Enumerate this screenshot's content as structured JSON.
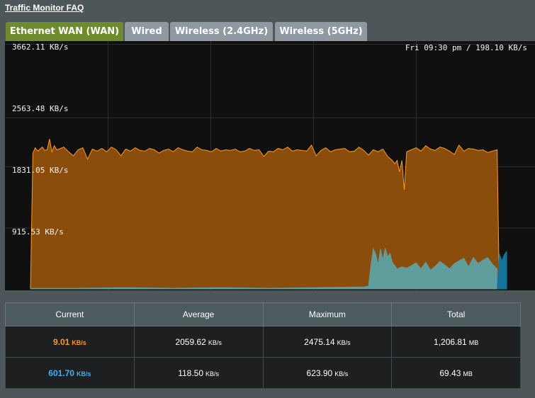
{
  "header": {
    "faq_link": "Traffic Monitor FAQ"
  },
  "tabs": [
    {
      "label": "Ethernet WAN (WAN)",
      "active": true
    },
    {
      "label": "Wired",
      "active": false
    },
    {
      "label": "Wireless (2.4GHz)",
      "active": false
    },
    {
      "label": "Wireless (5GHz)",
      "active": false
    }
  ],
  "chart": {
    "y_labels": [
      "3662.11 KB/s",
      "2563.48 KB/s",
      "1831.05 KB/s",
      "915.53 KB/s"
    ],
    "tooltip": "Fri 09:30 pm / 198.10 KB/s",
    "colors": {
      "rx": "#ff9a1f",
      "tx": "#32b5ff",
      "rx_fill": "#8a4d0c",
      "tx_fill": "#5f9e9c",
      "tx_edge_fill": "#14739b"
    }
  },
  "chart_data": {
    "type": "area",
    "x_range": [
      0,
      100
    ],
    "ylim": [
      0,
      3662.11
    ],
    "y_ticks": [
      "3662.11 KB/s",
      "2563.48 KB/s",
      "1831.05 KB/s",
      "915.53 KB/s"
    ],
    "grid": true,
    "series": [
      {
        "role": "rx",
        "x": [
          0,
          0.5,
          1,
          1.5,
          2,
          2.5,
          3,
          3.5,
          4,
          4.5,
          5,
          5.5,
          6,
          7,
          8,
          9,
          10,
          11,
          12,
          13,
          14,
          15,
          16,
          17,
          18,
          19,
          20,
          21,
          22,
          23,
          24,
          25,
          26,
          27,
          28,
          29,
          30,
          31,
          32,
          33,
          34,
          35,
          36,
          37,
          38,
          39,
          40,
          41,
          42,
          43,
          44,
          45,
          46,
          47,
          48,
          49,
          50,
          51,
          52,
          53,
          54,
          55,
          56,
          57,
          58,
          59,
          60,
          61,
          62,
          63,
          64,
          65,
          66,
          67,
          68,
          69,
          70,
          71,
          72,
          73,
          74,
          75,
          75.5,
          76,
          76.5,
          77,
          77.5,
          78,
          78.5,
          79,
          80,
          81,
          82,
          83,
          84,
          85,
          86,
          87,
          88,
          89,
          90,
          91,
          92,
          93,
          94,
          95,
          96,
          97,
          98
        ],
        "values": [
          0,
          2030,
          2110,
          2060,
          2090,
          2120,
          2070,
          2080,
          2240,
          2050,
          2140,
          2080,
          2090,
          2120,
          2050,
          1990,
          2080,
          2110,
          1940,
          2090,
          2060,
          2100,
          2050,
          2120,
          2080,
          1990,
          2090,
          2060,
          2110,
          2070,
          2060,
          2100,
          2080,
          2030,
          2070,
          2090,
          2050,
          2110,
          2080,
          2060,
          2050,
          2120,
          2080,
          2070,
          2050,
          2100,
          2060,
          2080,
          2070,
          2090,
          2050,
          2060,
          2100,
          2070,
          2080,
          1980,
          2060,
          2050,
          2100,
          2080,
          2120,
          2060,
          2080,
          2070,
          2060,
          2150,
          1990,
          2070,
          2110,
          2050,
          2080,
          2090,
          2100,
          2050,
          2060,
          2120,
          2070,
          2000,
          2080,
          2050,
          2090,
          1980,
          1950,
          1920,
          1870,
          1920,
          1750,
          1920,
          1480,
          2050,
          2080,
          2110,
          2060,
          2140,
          2090,
          2070,
          2120,
          2100,
          2060,
          2010,
          2150,
          2060,
          2100,
          2090,
          2070,
          2080,
          2040,
          2060,
          2080
        ]
      },
      {
        "role": "tx",
        "x": [
          0,
          10,
          20,
          30,
          40,
          50,
          60,
          70,
          71,
          71.5,
          72,
          72.5,
          73,
          73.5,
          74,
          74.5,
          75,
          75.5,
          76,
          77,
          78,
          79,
          80,
          81,
          82,
          83,
          84,
          85,
          86,
          87,
          88,
          89,
          90,
          91,
          92,
          93,
          94,
          95,
          96,
          97,
          98
        ],
        "values": [
          10,
          10,
          20,
          10,
          20,
          10,
          20,
          30,
          40,
          350,
          600,
          520,
          360,
          600,
          430,
          610,
          480,
          530,
          400,
          300,
          330,
          310,
          350,
          390,
          300,
          400,
          280,
          340,
          410,
          360,
          300,
          380,
          420,
          460,
          330,
          470,
          380,
          430,
          470,
          370,
          300
        ]
      },
      {
        "role": "tx_recent",
        "x": [
          98,
          98.5,
          99,
          99.5,
          100
        ],
        "values": [
          0,
          520,
          420,
          510,
          560
        ]
      }
    ]
  },
  "stats": {
    "headers": [
      "Current",
      "Average",
      "Maximum",
      "Total"
    ],
    "rows": [
      {
        "current": "9.01",
        "current_unit": "KB/s",
        "average": "2059.62",
        "average_unit": "KB/s",
        "maximum": "2475.14",
        "maximum_unit": "KB/s",
        "total": "1,206.81",
        "total_unit": "MB"
      },
      {
        "current": "601.70",
        "current_unit": "KB/s",
        "average": "118.50",
        "average_unit": "KB/s",
        "maximum": "623.90",
        "maximum_unit": "KB/s",
        "total": "69.43",
        "total_unit": "MB"
      }
    ]
  }
}
